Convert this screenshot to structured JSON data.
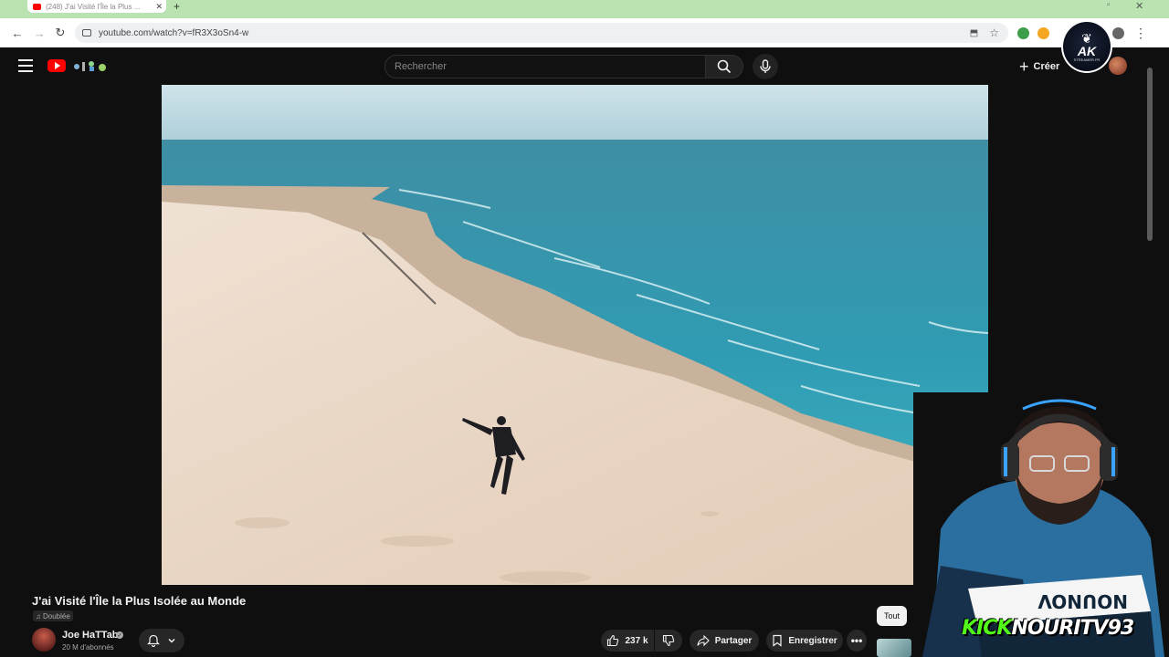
{
  "browser": {
    "tab_title": "(248) J'ai Visité l'Île la Plus ...",
    "url": "youtube.com/watch?v=fR3X3oSn4-w"
  },
  "youtube": {
    "search_placeholder": "Rechercher",
    "create_label": "Créer",
    "brand_color": "#ff0000"
  },
  "video": {
    "title": "J'ai Visité l'Île la Plus Isolée au Monde",
    "dubbed_label": "Doublée",
    "channel_name": "Joe HaTTab",
    "subscribers": "20 M d'abonnés",
    "likes": "237 k",
    "share_label": "Partager",
    "save_label": "Enregistrer"
  },
  "chips": {
    "all_label": "Tout"
  },
  "overlay": {
    "badge_text": "AK",
    "badge_sub": "STREAMER FR",
    "kick_prefix": "KICK",
    "kick_name": "NOURITV93",
    "kick_color": "#53fc18"
  },
  "icons": [
    "back-icon",
    "forward-icon",
    "reload-icon",
    "site-info-icon",
    "install-icon",
    "star-icon",
    "hamburger-icon",
    "search-icon",
    "mic-icon",
    "plus-icon",
    "bell-icon",
    "chevron-down-icon",
    "like-icon",
    "dislike-icon",
    "share-icon",
    "bookmark-icon",
    "more-icon"
  ]
}
